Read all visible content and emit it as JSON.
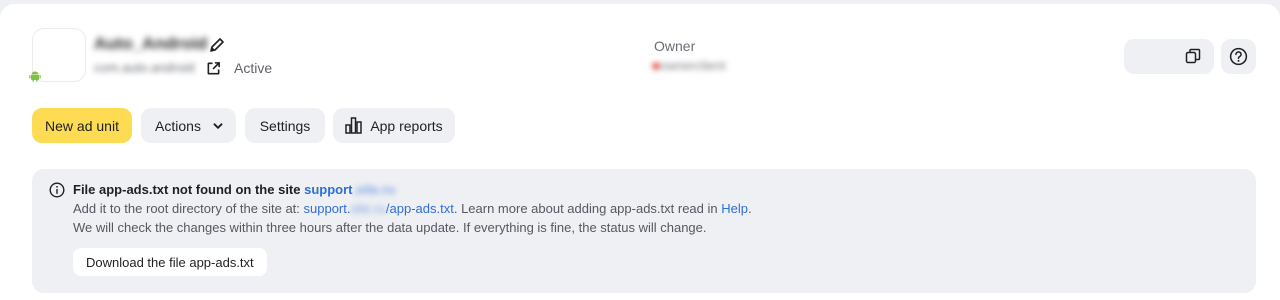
{
  "app": {
    "name": "Auto_Android",
    "bundle_id": "com.auto.android",
    "status": "Active"
  },
  "owner": {
    "label": "Owner",
    "value": "ownerclient"
  },
  "toolbar": {
    "new_ad_unit": "New ad unit",
    "actions": "Actions",
    "settings": "Settings",
    "app_reports": "App reports"
  },
  "notice": {
    "title_prefix": "File app-ads.txt not found on the site ",
    "title_site_visible": "support",
    "title_site_hidden": ".site.ru",
    "line1_prefix": "Add it to the root directory of the site at: ",
    "line1_link_start": "support.",
    "line1_link_hidden": "site.ru",
    "line1_link_end": "/app-ads.txt",
    "line1_mid": ". Learn more about adding app-ads.txt read in ",
    "line1_help": "Help",
    "line1_end": ".",
    "line2": "We will check the changes within three hours after the data update. If everything is fine, the status will change.",
    "download_button": "Download the file app-ads.txt"
  },
  "colors": {
    "primary_button": "#fddb52",
    "link": "#2f6fd8",
    "android_green": "#7cc244"
  },
  "icons": [
    "android-icon",
    "pencil-icon",
    "external-link-icon",
    "copy-icon",
    "help-icon",
    "chevron-down-icon",
    "bar-chart-icon",
    "info-icon"
  ]
}
